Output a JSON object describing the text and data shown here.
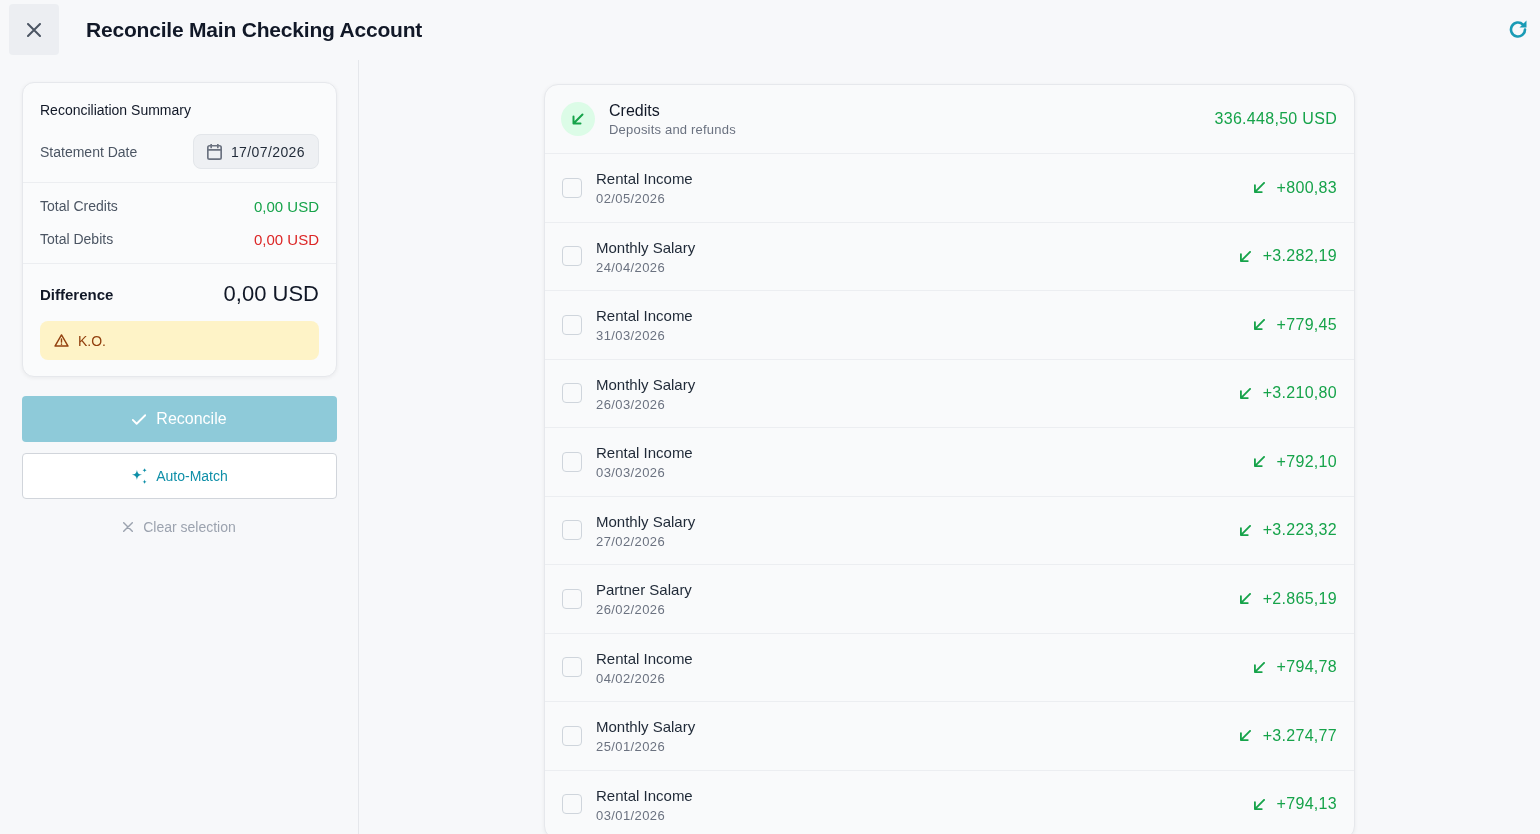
{
  "header": {
    "title": "Reconcile Main Checking Account"
  },
  "summary": {
    "title": "Reconciliation Summary",
    "statement_date": {
      "label": "Statement Date",
      "value": "17/07/2026"
    },
    "totals": [
      {
        "label": "Total Credits",
        "value": "0,00 USD",
        "kind": "credit"
      },
      {
        "label": "Total Debits",
        "value": "0,00 USD",
        "kind": "debit"
      }
    ],
    "difference": {
      "label": "Difference",
      "value": "0,00 USD"
    },
    "status": {
      "kind": "warning",
      "text": "K.O."
    }
  },
  "actions": {
    "reconcile": {
      "label": "Reconcile",
      "disabled": true
    },
    "auto_match": {
      "label": "Auto-Match"
    },
    "clear": {
      "label": "Clear selection"
    }
  },
  "credits": {
    "title": "Credits",
    "subtitle": "Deposits and refunds",
    "total": "336.448,50 USD",
    "rows": [
      {
        "name": "Rental Income",
        "date": "02/05/2026",
        "amount": "+800,83",
        "checked": false
      },
      {
        "name": "Monthly Salary",
        "date": "24/04/2026",
        "amount": "+3.282,19",
        "checked": false
      },
      {
        "name": "Rental Income",
        "date": "31/03/2026",
        "amount": "+779,45",
        "checked": false
      },
      {
        "name": "Monthly Salary",
        "date": "26/03/2026",
        "amount": "+3.210,80",
        "checked": false
      },
      {
        "name": "Rental Income",
        "date": "03/03/2026",
        "amount": "+792,10",
        "checked": false
      },
      {
        "name": "Monthly Salary",
        "date": "27/02/2026",
        "amount": "+3.223,32",
        "checked": false
      },
      {
        "name": "Partner Salary",
        "date": "26/02/2026",
        "amount": "+2.865,19",
        "checked": false
      },
      {
        "name": "Rental Income",
        "date": "04/02/2026",
        "amount": "+794,78",
        "checked": false
      },
      {
        "name": "Monthly Salary",
        "date": "25/01/2026",
        "amount": "+3.274,77",
        "checked": false
      },
      {
        "name": "Rental Income",
        "date": "03/01/2026",
        "amount": "+794,13",
        "checked": false
      }
    ]
  }
}
